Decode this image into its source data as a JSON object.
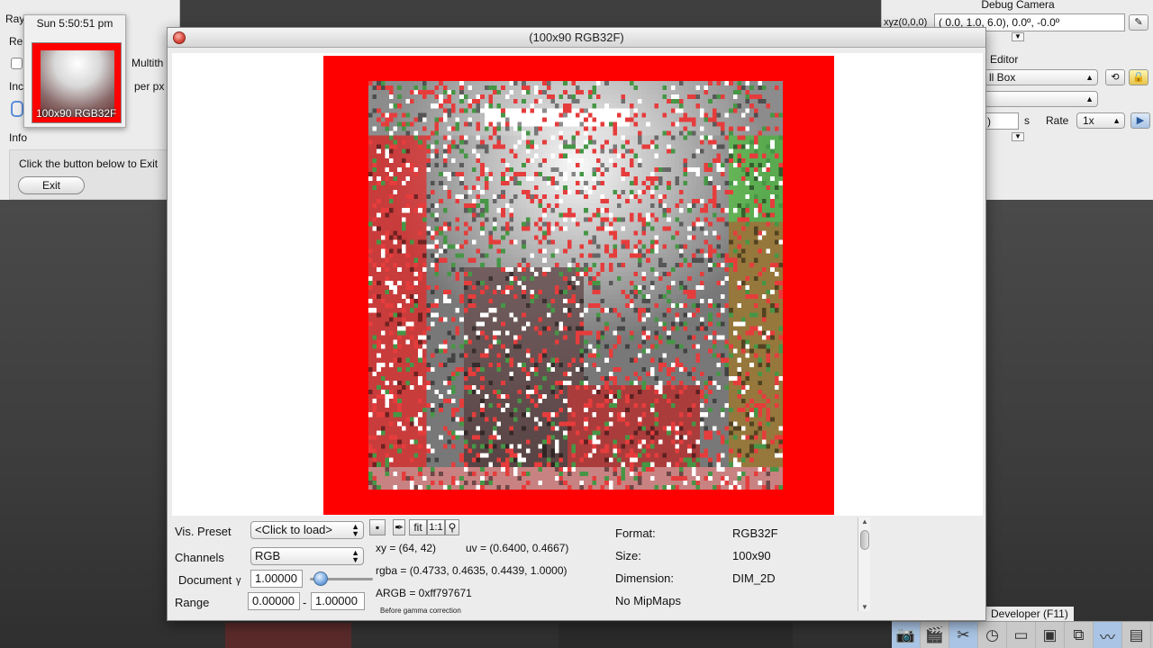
{
  "background": {
    "left_panel": {
      "title_fragment": "Ray",
      "row2_fragment": "Re",
      "multithread_fragment": "Multith",
      "per_px_fragment": "per px",
      "inc_fragment": "Inc",
      "info_label": "Info",
      "exit_note": "Click the button below to Exit",
      "exit_button": "Exit"
    },
    "thumbnail": {
      "time": "Sun 5:50:51 pm",
      "label": "100x90 RGB32F"
    },
    "right_panel": {
      "debug_camera_title": "Debug Camera",
      "xyz_label": "xyz(0,0,0)",
      "camera_value": "(  0.0,   1.0,   6.0),   0.0º,  -0.0º",
      "scene_editor_title": "Scene Editor",
      "scene_select": "ll Box",
      "time_fragment": ")",
      "time_unit": "s",
      "rate_label": "Rate",
      "rate_value": "1x"
    },
    "developer_label": "Developer (F11)",
    "toolbar_icons": [
      "camera-icon",
      "clapper-icon",
      "tools-icon",
      "clock-icon",
      "note-icon",
      "terminal-icon",
      "windows-icon",
      "graph-icon",
      "document-icon"
    ]
  },
  "window": {
    "title": "(100x90 RGB32F)"
  },
  "info": {
    "vis_preset_label": "Vis. Preset",
    "vis_preset_value": "<Click to load>",
    "channels_label": "Channels",
    "channels_value": "RGB",
    "document_label": "Document",
    "gamma_symbol": "γ",
    "gamma_value": "1.00000",
    "range_label": "Range",
    "range_min": "0.00000",
    "range_dash": "-",
    "range_max": "1.00000",
    "tool_fit": "fit",
    "tool_1to1": "1:1",
    "xy": "xy =  (64, 42)",
    "uv": "uv =  (0.6400, 0.4667)",
    "rgba": "rgba =  (0.4733, 0.4635, 0.4439, 1.0000)",
    "argb": "ARGB =  0xff797671",
    "gamma_note": "Before gamma correction",
    "format_label": "Format:",
    "format_value": "RGB32F",
    "size_label": "Size:",
    "size_value": "100x90",
    "dimension_label": "Dimension:",
    "dimension_value": "DIM_2D",
    "mipmaps": "No MipMaps"
  }
}
